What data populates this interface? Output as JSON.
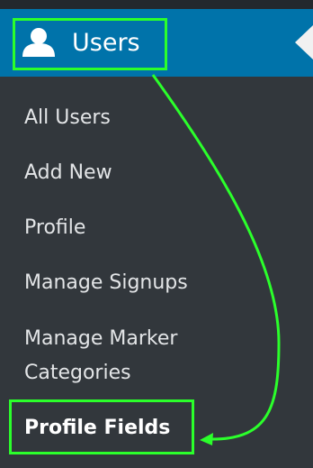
{
  "menu": {
    "parent": {
      "label": "Users",
      "icon": "user-icon"
    },
    "submenu": [
      {
        "label": "All Users"
      },
      {
        "label": "Add New"
      },
      {
        "label": "Profile"
      },
      {
        "label": "Manage Signups"
      },
      {
        "label": "Manage Marker Categories"
      },
      {
        "label": "Profile Fields",
        "current": true
      }
    ]
  },
  "colors": {
    "admin_sidebar": "#32373c",
    "active_menu": "#0073aa",
    "annotation": "#2bff2b"
  }
}
